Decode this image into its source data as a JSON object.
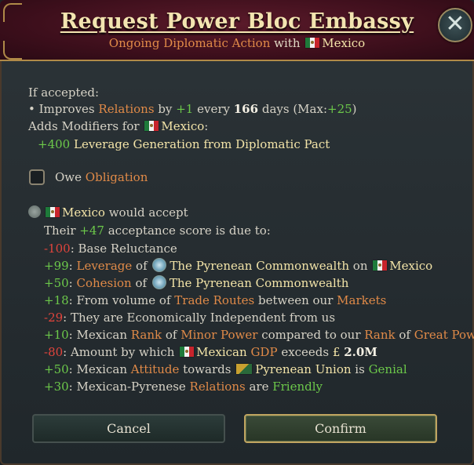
{
  "dialog": {
    "title": "Request Power Bloc Embassy",
    "subtitle": {
      "action": "Ongoing Diplomatic Action",
      "with_word": "with",
      "country": "Mexico"
    },
    "close_label": "✕"
  },
  "effects": {
    "if_accepted": "If accepted:",
    "bullet": {
      "prefix": "• Improves",
      "relations": "Relations",
      "by": "by",
      "amount": "+1",
      "every": "every",
      "days": "166",
      "days_word": "days (Max:",
      "max": "+25",
      "close_paren": ")"
    },
    "adds_modifiers": "Adds Modifiers for",
    "modifiers_country": "Mexico",
    "modifiers_colon": ":",
    "modifier_value": "+400",
    "modifier_text": "Leverage Generation from Diplomatic Pact"
  },
  "obligation": {
    "prefix": "Owe",
    "label": "Obligation",
    "checked": false
  },
  "acceptance": {
    "country": "Mexico",
    "verdict": "would accept",
    "score_prefix": "Their",
    "score": "+47",
    "score_suffix": "acceptance score is due to:",
    "factors": [
      {
        "value": "-100",
        "parts": [
          {
            "t": ": Base Reluctance"
          }
        ]
      },
      {
        "value": "+99",
        "parts": [
          {
            "t": ": "
          },
          {
            "t": "Leverage",
            "c": "orange"
          },
          {
            "t": " of "
          },
          {
            "icon": "emblem"
          },
          {
            "t": "The Pyrenean Commonwealth",
            "c": "yellow"
          },
          {
            "t": " on "
          },
          {
            "icon": "flag-mx"
          },
          {
            "t": "Mexico",
            "c": "yellow"
          }
        ]
      },
      {
        "value": "+50",
        "parts": [
          {
            "t": ": "
          },
          {
            "t": "Cohesion",
            "c": "orange"
          },
          {
            "t": " of "
          },
          {
            "icon": "emblem"
          },
          {
            "t": "The Pyrenean Commonwealth",
            "c": "yellow"
          }
        ]
      },
      {
        "value": "+18",
        "parts": [
          {
            "t": ": From volume of "
          },
          {
            "t": "Trade Routes",
            "c": "orange"
          },
          {
            "t": " between our "
          },
          {
            "t": "Markets",
            "c": "orange"
          }
        ]
      },
      {
        "value": "-29",
        "parts": [
          {
            "t": ": They are Economically Independent from us"
          }
        ]
      },
      {
        "value": "+10",
        "parts": [
          {
            "t": ": Mexican "
          },
          {
            "t": "Rank",
            "c": "orange"
          },
          {
            "t": " of "
          },
          {
            "t": "Minor Power",
            "c": "orange"
          },
          {
            "t": " compared to our "
          },
          {
            "t": "Rank",
            "c": "orange"
          },
          {
            "t": " of "
          },
          {
            "t": "Great Power",
            "c": "orange"
          }
        ]
      },
      {
        "value": "-80",
        "parts": [
          {
            "t": ": Amount by which "
          },
          {
            "icon": "flag-mx"
          },
          {
            "t": "Mexican",
            "c": "yellow"
          },
          {
            "t": " "
          },
          {
            "t": "GDP",
            "c": "orange"
          },
          {
            "t": " exceeds "
          },
          {
            "t": "£",
            "c": "yellow"
          },
          {
            "t": " "
          },
          {
            "t": "2.0M",
            "c": "white"
          }
        ]
      },
      {
        "value": "+50",
        "parts": [
          {
            "t": ": Mexican "
          },
          {
            "t": "Attitude",
            "c": "orange"
          },
          {
            "t": " towards "
          },
          {
            "icon": "flag-pu"
          },
          {
            "t": "Pyrenean Union",
            "c": "yellow"
          },
          {
            "t": " is "
          },
          {
            "t": "Genial",
            "c": "green"
          }
        ]
      },
      {
        "value": "+30",
        "parts": [
          {
            "t": ": Mexican-Pyrenese "
          },
          {
            "t": "Relations",
            "c": "orange"
          },
          {
            "t": " are "
          },
          {
            "t": "Friendly",
            "c": "green"
          }
        ]
      }
    ]
  },
  "buttons": {
    "cancel": "Cancel",
    "confirm": "Confirm"
  },
  "colors": {
    "positive": "#6cc84a",
    "negative": "#e0443c",
    "keyword": "#e08a48",
    "name": "#f3e4a8",
    "title": "#f3e4b0"
  }
}
